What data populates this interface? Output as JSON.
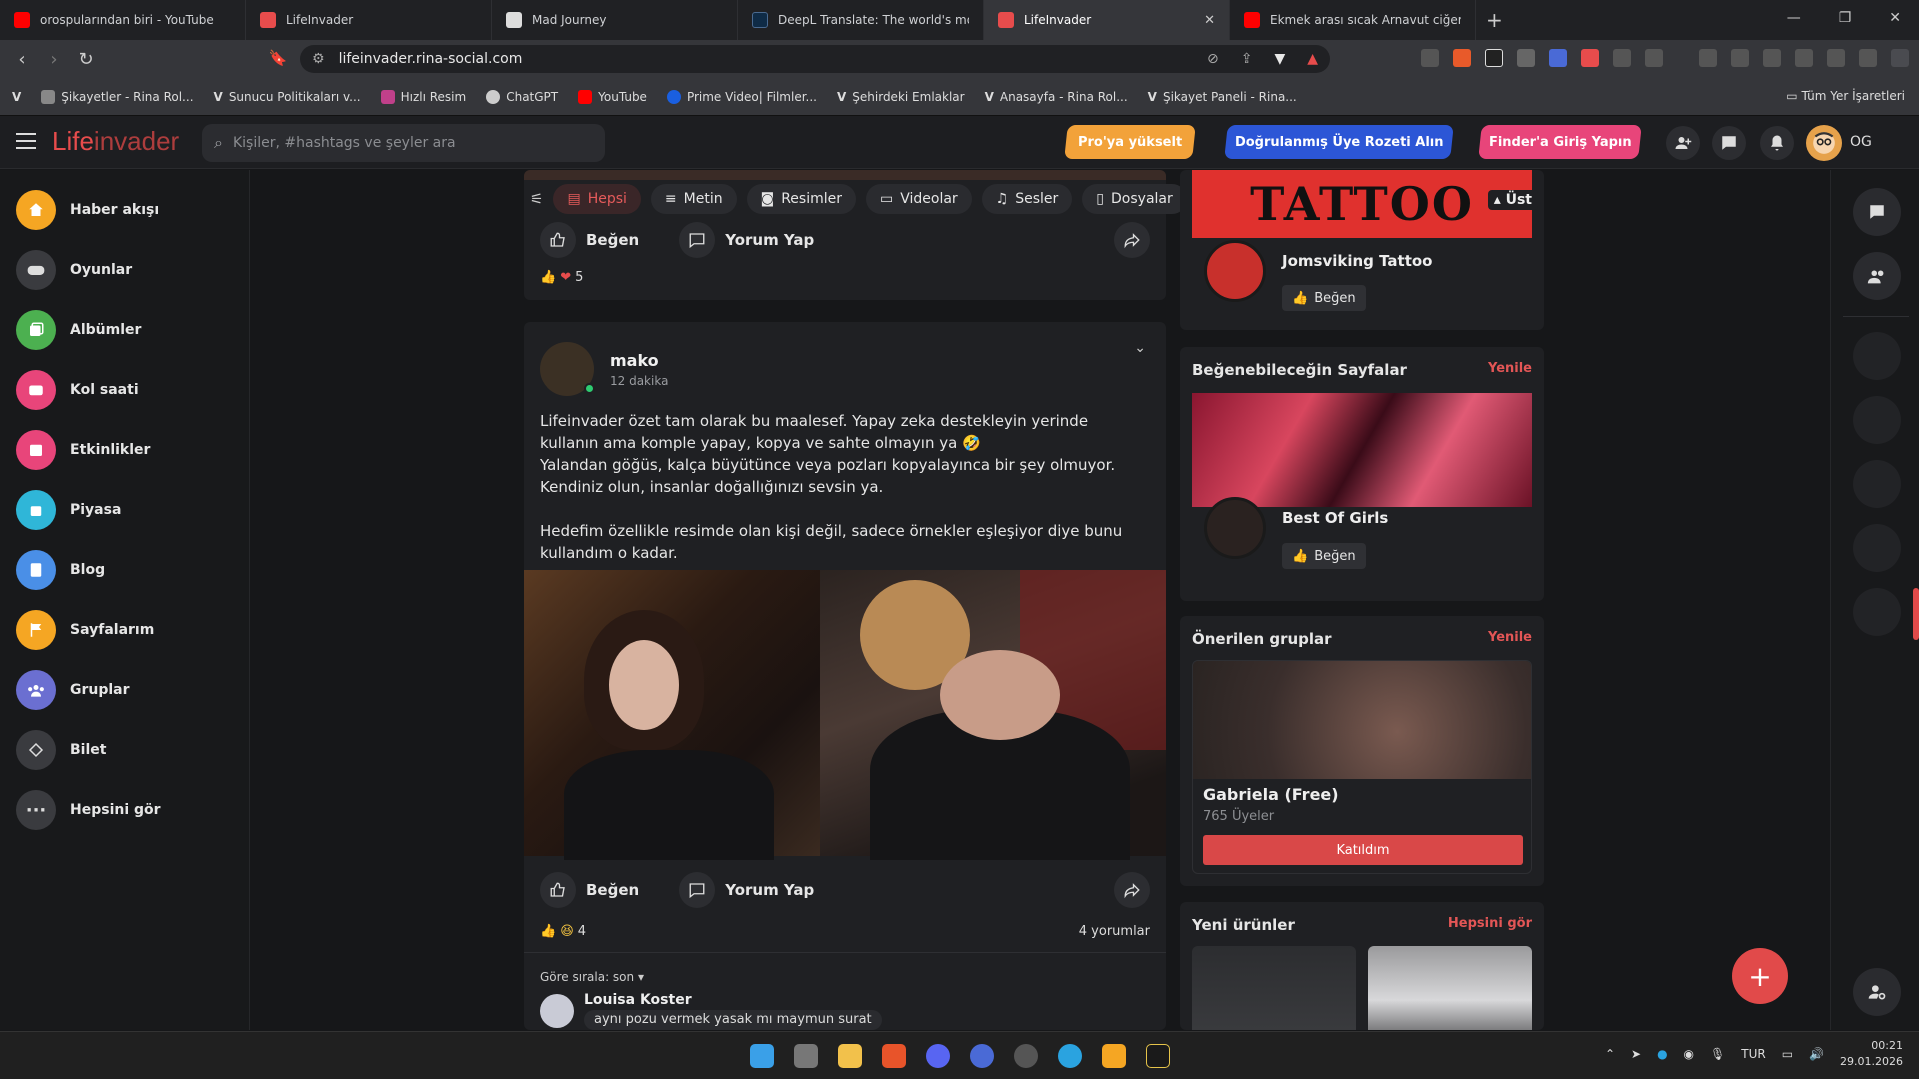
{
  "browser": {
    "tabs": [
      {
        "title": "orospularından biri - YouTube",
        "color": "#ff0000",
        "active": false
      },
      {
        "title": "LifeInvader",
        "color": "#e74c4c",
        "active": false
      },
      {
        "title": "Mad Journey",
        "color": "#dddddd",
        "active": false
      },
      {
        "title": "DeepL Translate: The world's most ac",
        "color": "#0f2b46",
        "active": false
      },
      {
        "title": "LifeInvader",
        "color": "#e74c4c",
        "active": true
      },
      {
        "title": "Ekmek arası sıcak Arnavut ciğeri 😍 #",
        "color": "#ff0000",
        "active": false
      }
    ],
    "url": "lifeinvader.rina-social.com",
    "bookmarks": [
      "Şikayetler - Rina Rol...",
      "Sunucu Politikaları v...",
      "Hızlı Resim",
      "ChatGPT",
      "YouTube",
      "Prime Video| Filmler...",
      "Şehirdeki Emlaklar",
      "Anasayfa - Rina Rol...",
      "Şikayet Paneli - Rina..."
    ],
    "bookmarks_all": "Tüm Yer İşaretleri"
  },
  "header": {
    "logo_a": "Life",
    "logo_b": "invader",
    "search_placeholder": "Kişiler, #hashtags ve şeyler ara",
    "btn_pro": "Pro'ya yükselt",
    "btn_verified": "Doğrulanmış Üye Rozeti Alın",
    "btn_finder": "Finder'a Giriş Yapın",
    "user_initials": "OG",
    "colors": {
      "pro": "#f2a23a",
      "verified": "#2c56d6",
      "finder": "#e8457a"
    }
  },
  "sidebar": {
    "items": [
      {
        "label": "Haber akışı",
        "icon": "home-icon",
        "color": "#f5a623"
      },
      {
        "label": "Oyunlar",
        "icon": "gamepad-icon",
        "color": "#3a3b3f"
      },
      {
        "label": "Albümler",
        "icon": "album-icon",
        "color": "#4cb050"
      },
      {
        "label": "Kol saati",
        "icon": "watch-icon",
        "color": "#e8457a"
      },
      {
        "label": "Etkinlikler",
        "icon": "calendar-icon",
        "color": "#e8457a"
      },
      {
        "label": "Piyasa",
        "icon": "market-icon",
        "color": "#2fb6d8"
      },
      {
        "label": "Blog",
        "icon": "blog-icon",
        "color": "#4a8fe7"
      },
      {
        "label": "Sayfalarım",
        "icon": "flag-icon",
        "color": "#f5a623"
      },
      {
        "label": "Gruplar",
        "icon": "groups-icon",
        "color": "#6b6fd1"
      },
      {
        "label": "Bilet",
        "icon": "ticket-icon",
        "color": "#3a3b3f"
      },
      {
        "label": "Hepsini gör",
        "icon": "more-icon",
        "color": "#3a3b3f"
      }
    ]
  },
  "filters": [
    "Hepsi",
    "Metin",
    "Resimler",
    "Videolar",
    "Sesler",
    "Dosyalar"
  ],
  "top_post": {
    "like": "Beğen",
    "comment": "Yorum Yap",
    "reactions": "5"
  },
  "post": {
    "author": "mako",
    "time": "12 dakika",
    "text": "Lifeinvader özet tam olarak bu maalesef. Yapay zeka destekleyin yerinde kullanın ama komple yapay, kopya ve sahte olmayın ya 🤣\nYalandan göğüs, kalça büyütünce veya pozları kopyalayınca bir şey olmuyor.\nKendiniz olun, insanlar doğallığınızı sevsin ya.\n\nHedefim özellikle resimde olan kişi değil, sadece örnekler eşleşiyor diye bunu kullandım o kadar.",
    "like": "Beğen",
    "comment": "Yorum Yap",
    "reactions": "4",
    "comments_count": "4 yorumlar",
    "sort_label": "Göre sırala: son",
    "first_comment_author": "Louisa Koster",
    "first_comment_text": "aynı pozu vermek yasak mı maymun surat"
  },
  "right": {
    "top_label": "Üst",
    "banner_text": "TATTOO",
    "page1_name": "Jomsviking Tattoo",
    "like": "Beğen",
    "suggested_title": "Beğenebileceğin Sayfalar",
    "refresh": "Yenile",
    "page2_name": "Best Of Girls",
    "groups_title": "Önerilen gruplar",
    "group_name": "Gabriela (Free)",
    "group_members": "765 Üyeler",
    "group_join": "Katıldım",
    "products_title": "Yeni ürünler",
    "products_link": "Hepsini gör"
  },
  "taskbar": {
    "lang": "TUR",
    "time": "00:21",
    "date": "29.01.2026"
  }
}
